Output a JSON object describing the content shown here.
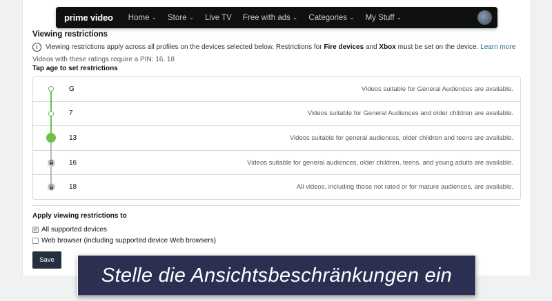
{
  "nav": {
    "logo": "prime video",
    "items": [
      {
        "label": "Home",
        "chevron": true
      },
      {
        "label": "Store",
        "chevron": true
      },
      {
        "label": "Live TV",
        "chevron": false
      },
      {
        "label": "Free with ads",
        "chevron": true
      },
      {
        "label": "Categories",
        "chevron": true
      },
      {
        "label": "My Stuff",
        "chevron": true
      }
    ]
  },
  "restrictions": {
    "title": "Viewing restrictions",
    "info_prefix": "Viewing restrictions apply across all profiles on the devices selected below. Restrictions for",
    "info_fire": "Fire devices",
    "info_and": "and",
    "info_xbox": "Xbox",
    "info_suffix": "must be set on the device.",
    "learn_more": "Learn more",
    "pin_note": "Videos with these ratings require a PIN: 16, 18",
    "tap_label": "Tap age to set restrictions",
    "ratings": [
      {
        "label": "G",
        "desc": "Videos suitable for General Audiences are available.",
        "state": "open"
      },
      {
        "label": "7",
        "desc": "Videos suitable for General Audiences and older children are available.",
        "state": "open"
      },
      {
        "label": "13",
        "desc": "Videos suitable for general audiences, older children and teens are available.",
        "state": "selected"
      },
      {
        "label": "16",
        "desc": "Videos suitable for general audiences, older children, teens, and young adults are available.",
        "state": "locked"
      },
      {
        "label": "18",
        "desc": "All videos, including those not rated or for mature audiences, are available.",
        "state": "locked"
      }
    ]
  },
  "apply": {
    "title": "Apply viewing restrictions to",
    "options": [
      {
        "label": "All supported devices",
        "checked": true
      },
      {
        "label": "Web browser (including supported device Web browsers)",
        "checked": false
      }
    ],
    "save_label": "Save"
  },
  "caption": "Stelle die Ansichtsbeschränkungen ein",
  "colors": {
    "accent_green": "#6cc04a",
    "nav_bg": "#0f1111",
    "button_bg": "#232f3e",
    "caption_bg": "#2b2f52"
  }
}
